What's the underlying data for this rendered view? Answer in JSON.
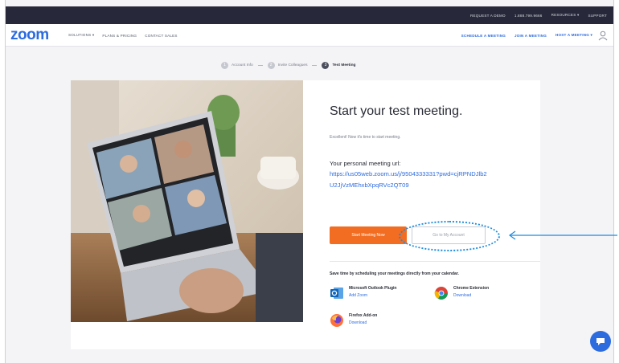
{
  "topbar": {
    "links": [
      "REQUEST A DEMO",
      "1.888.799.9666",
      "RESOURCES",
      "SUPPORT"
    ],
    "dropdown_chevron": "▾"
  },
  "nav": {
    "logo": "zoom",
    "left_items": [
      "SOLUTIONS",
      "PLANS & PRICING",
      "CONTACT SALES"
    ],
    "right_items": [
      "SCHEDULE A MEETING",
      "JOIN A MEETING",
      "HOST A MEETING"
    ],
    "dropdown_chevron": "▾",
    "avatar_icon": "user-avatar-icon"
  },
  "stepper": {
    "steps": [
      {
        "num": "1",
        "label": "Account Info"
      },
      {
        "num": "2",
        "label": "Invite Colleagues"
      },
      {
        "num": "3",
        "label": "Test Meeting"
      }
    ]
  },
  "main": {
    "title": "Start your test meeting.",
    "subtitle": "Excellent! Now it's time to start meeting.",
    "url_label": "Your personal meeting url:",
    "url_line1": "https://us05web.zoom.us/j/9504333331?pwd=cjRPNDJlb2",
    "url_line2": "U2JjVzMEhxbXpqRVc2QT09",
    "start_button": "Start Meeting Now",
    "account_button": "Go to My Account",
    "save_time_text": "Save time by scheduling your meetings directly from your calendar.",
    "plugins": [
      {
        "name": "Microsoft Outlook Plugin",
        "link": "Add Zoom",
        "icon": "outlook-icon"
      },
      {
        "name": "Chrome Extension",
        "link": "Download",
        "icon": "chrome-icon"
      },
      {
        "name": "Firefox Add-on",
        "link": "Download",
        "icon": "firefox-icon"
      }
    ]
  },
  "colors": {
    "brand_blue": "#2d6cdf",
    "cta_orange": "#f26d21",
    "topbar_bg": "#27293a",
    "annotation_blue": "#1a8be0"
  }
}
